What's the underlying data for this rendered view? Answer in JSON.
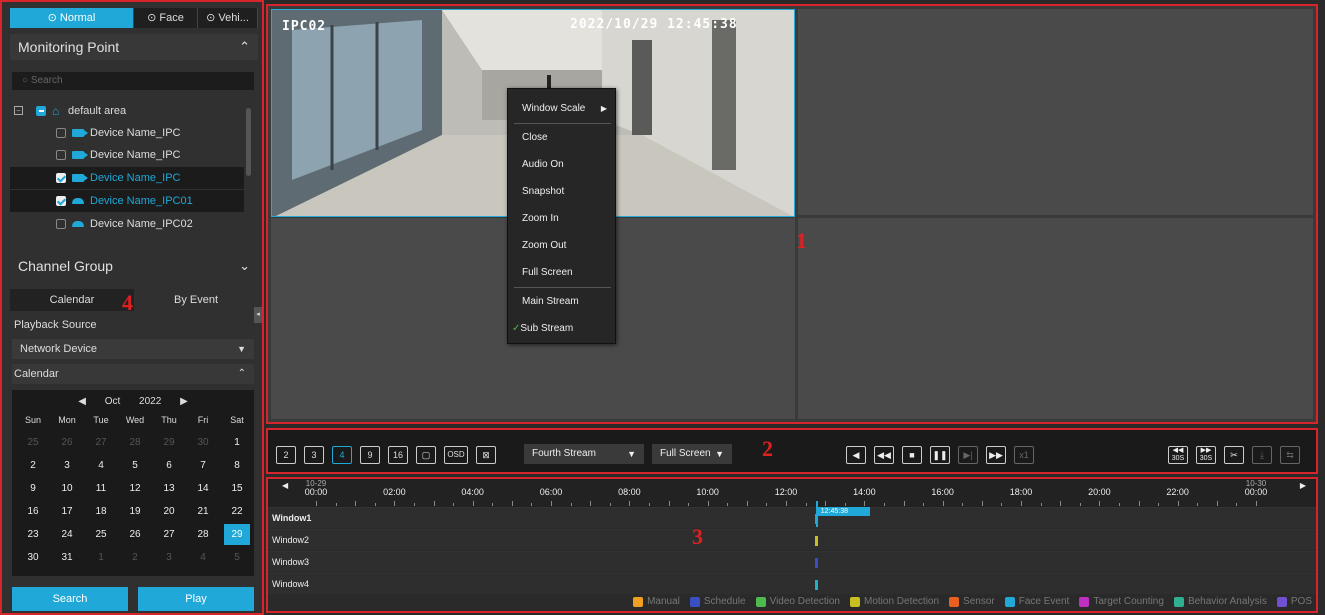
{
  "left_panel": {
    "tabs": [
      {
        "label": "Normal",
        "icon": "record-icon",
        "active": true
      },
      {
        "label": "Face",
        "icon": "face-icon",
        "active": false
      },
      {
        "label": "Vehi...",
        "icon": "vehicle-icon",
        "active": false
      }
    ],
    "monitoring_point": {
      "title": "Monitoring Point",
      "search_placeholder": "Search",
      "tree": [
        {
          "label": "default area",
          "type": "area",
          "checkbox": "partial",
          "expanded": true
        },
        {
          "label": "Device Name_IPC",
          "type": "bullet",
          "checkbox": "unchecked",
          "selected": false
        },
        {
          "label": "Device Name_IPC",
          "type": "bullet",
          "checkbox": "unchecked",
          "selected": false
        },
        {
          "label": "Device Name_IPC",
          "type": "bullet",
          "checkbox": "checked",
          "selected": true
        },
        {
          "label": "Device Name_IPC01",
          "type": "dome",
          "checkbox": "checked",
          "selected": true
        },
        {
          "label": "Device Name_IPC02",
          "type": "dome",
          "checkbox": "unchecked",
          "selected": false
        }
      ]
    },
    "channel_group": {
      "title": "Channel Group"
    },
    "subtabs": [
      {
        "label": "Calendar",
        "active": true
      },
      {
        "label": "By Event",
        "active": false
      }
    ],
    "playback_source": {
      "label": "Playback Source",
      "value": "Network Device"
    },
    "calendar": {
      "label": "Calendar",
      "month": "Oct",
      "year": "2022",
      "weekdays": [
        "Sun",
        "Mon",
        "Tue",
        "Wed",
        "Thu",
        "Fri",
        "Sat"
      ],
      "weeks": [
        [
          {
            "d": "25",
            "dim": true
          },
          {
            "d": "26",
            "dim": true
          },
          {
            "d": "27",
            "dim": true
          },
          {
            "d": "28",
            "dim": true
          },
          {
            "d": "29",
            "dim": true
          },
          {
            "d": "30",
            "dim": true
          },
          {
            "d": "1"
          }
        ],
        [
          {
            "d": "2"
          },
          {
            "d": "3"
          },
          {
            "d": "4"
          },
          {
            "d": "5"
          },
          {
            "d": "6"
          },
          {
            "d": "7"
          },
          {
            "d": "8"
          }
        ],
        [
          {
            "d": "9"
          },
          {
            "d": "10"
          },
          {
            "d": "11"
          },
          {
            "d": "12"
          },
          {
            "d": "13"
          },
          {
            "d": "14"
          },
          {
            "d": "15"
          }
        ],
        [
          {
            "d": "16"
          },
          {
            "d": "17"
          },
          {
            "d": "18"
          },
          {
            "d": "19"
          },
          {
            "d": "20"
          },
          {
            "d": "21"
          },
          {
            "d": "22"
          }
        ],
        [
          {
            "d": "23"
          },
          {
            "d": "24"
          },
          {
            "d": "25"
          },
          {
            "d": "26"
          },
          {
            "d": "27"
          },
          {
            "d": "28"
          },
          {
            "d": "29",
            "today": true
          }
        ],
        [
          {
            "d": "30"
          },
          {
            "d": "31"
          },
          {
            "d": "1",
            "dim": true
          },
          {
            "d": "2",
            "dim": true
          },
          {
            "d": "3",
            "dim": true
          },
          {
            "d": "4",
            "dim": true
          },
          {
            "d": "5",
            "dim": true
          }
        ]
      ]
    },
    "search_button": "Search",
    "play_button": "Play"
  },
  "video": {
    "osd_name": "IPC02",
    "osd_time": "2022/10/29 12:45:38",
    "context_menu": {
      "items": [
        "Window Scale",
        "Close",
        "Audio On",
        "Snapshot",
        "Zoom In",
        "Zoom Out",
        "Full Screen",
        "Main Stream",
        "Sub Stream"
      ],
      "checked": "Sub Stream"
    }
  },
  "toolbar": {
    "layout_buttons": [
      "2",
      "3",
      "4",
      "9",
      "16",
      "",
      "OSD",
      ""
    ],
    "active_layout": "4",
    "stream_select": "Fourth Stream",
    "screen_select": "Full Screen",
    "playback_icons": [
      "play-reverse-icon",
      "rewind-icon",
      "stop-icon",
      "pause-icon",
      "step-forward-icon",
      "fast-forward-icon"
    ],
    "speed": "x1",
    "right_buttons": [
      "30S",
      "30S"
    ]
  },
  "timeline": {
    "start_label": "10-29",
    "end_label": "10-30",
    "hours": [
      "00:00",
      "02:00",
      "04:00",
      "06:00",
      "08:00",
      "10:00",
      "12:00",
      "14:00",
      "16:00",
      "18:00",
      "20:00",
      "22:00",
      "00:00"
    ],
    "cursor_time": "12:45:38",
    "windows": [
      {
        "label": "Window1",
        "color": "#1fa8d8",
        "hour": 12.76
      },
      {
        "label": "Window2",
        "color": "#c8c020",
        "hour": 12.76
      },
      {
        "label": "Window3",
        "color": "#3b4fc4",
        "hour": 12.76
      },
      {
        "label": "Window4",
        "color": "#1fb0c8",
        "hour": 12.76
      }
    ],
    "legend": [
      {
        "label": "Manual",
        "color": "#f0a020"
      },
      {
        "label": "Schedule",
        "color": "#3b4fc4"
      },
      {
        "label": "Video Detection",
        "color": "#4cba4c"
      },
      {
        "label": "Motion Detection",
        "color": "#c8c020"
      },
      {
        "label": "Sensor",
        "color": "#e86020"
      },
      {
        "label": "Face Event",
        "color": "#1fa8d8"
      },
      {
        "label": "Target Counting",
        "color": "#c030c0"
      },
      {
        "label": "Behavior Analysis",
        "color": "#30b090"
      },
      {
        "label": "POS",
        "color": "#7050d0"
      }
    ]
  },
  "annotations": [
    "1",
    "2",
    "3",
    "4"
  ]
}
